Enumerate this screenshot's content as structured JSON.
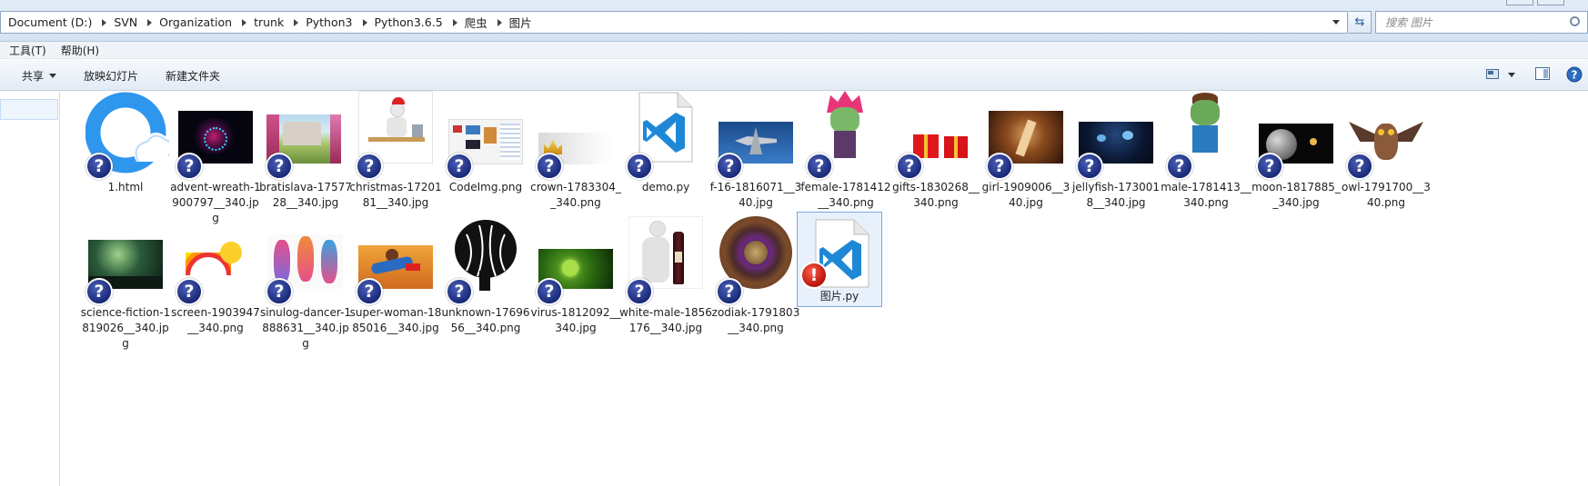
{
  "address": {
    "crumbs": [
      "Document (D:)",
      "SVN",
      "Organization",
      "trunk",
      "Python3",
      "Python3.6.5",
      "爬虫",
      "图片"
    ]
  },
  "search": {
    "placeholder": "搜索 图片"
  },
  "menu": {
    "items": [
      "工具(T)",
      "帮助(H)"
    ]
  },
  "toolbar": {
    "share": "共享",
    "slideshow": "放映幻灯片",
    "new_folder": "新建文件夹"
  },
  "files": [
    {
      "name": "1.html",
      "icon": "qq-browser-icon"
    },
    {
      "name": "advent-wreath-1900797__340.jpg",
      "icon": "image-thumbnail"
    },
    {
      "name": "bratislava-1757728__340.jpg",
      "icon": "image-thumbnail"
    },
    {
      "name": "christmas-1720181__340.jpg",
      "icon": "image-thumbnail"
    },
    {
      "name": "CodeImg.png",
      "icon": "image-thumbnail"
    },
    {
      "name": "crown-1783304__340.png",
      "icon": "image-thumbnail"
    },
    {
      "name": "demo.py",
      "icon": "vscode-icon"
    },
    {
      "name": "f-16-1816071__340.jpg",
      "icon": "image-thumbnail"
    },
    {
      "name": "female-1781412__340.png",
      "icon": "image-thumbnail"
    },
    {
      "name": "gifts-1830268__340.png",
      "icon": "image-thumbnail"
    },
    {
      "name": "girl-1909006__340.jpg",
      "icon": "image-thumbnail"
    },
    {
      "name": "jellyfish-1730018__340.jpg",
      "icon": "image-thumbnail"
    },
    {
      "name": "male-1781413__340.png",
      "icon": "image-thumbnail"
    },
    {
      "name": "moon-1817885__340.jpg",
      "icon": "image-thumbnail"
    },
    {
      "name": "owl-1791700__340.png",
      "icon": "image-thumbnail"
    },
    {
      "name": "science-fiction-1819026__340.jpg",
      "icon": "image-thumbnail"
    },
    {
      "name": "screen-1903947__340.png",
      "icon": "image-thumbnail"
    },
    {
      "name": "sinulog-dancer-1888631__340.jpg",
      "icon": "image-thumbnail"
    },
    {
      "name": "super-woman-1885016__340.jpg",
      "icon": "image-thumbnail"
    },
    {
      "name": "unknown-1769656__340.png",
      "icon": "image-thumbnail"
    },
    {
      "name": "virus-1812092__340.jpg",
      "icon": "image-thumbnail"
    },
    {
      "name": "white-male-1856176__340.jpg",
      "icon": "image-thumbnail"
    },
    {
      "name": "zodiak-1791803__340.png",
      "icon": "image-thumbnail"
    },
    {
      "name": "图片.py",
      "icon": "vscode-icon"
    }
  ],
  "colors": {
    "accent": "#2a5a9c",
    "selection": "#e8f1fb",
    "overlay_question": "#1a2a78",
    "overlay_error": "#b8140c"
  }
}
